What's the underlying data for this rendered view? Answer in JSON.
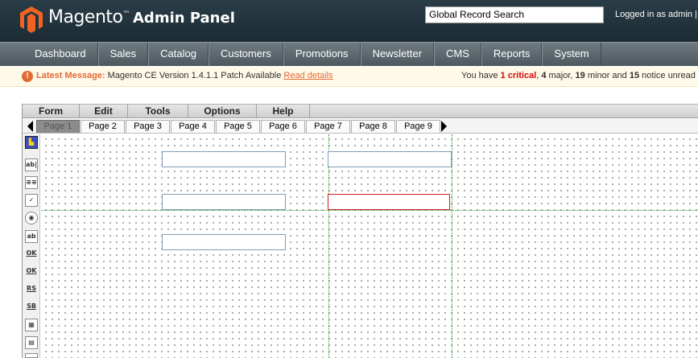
{
  "header": {
    "logo_text": "Magento",
    "logo_tm": "™",
    "logo_sub": "Admin Panel",
    "search_value": "Global Record Search",
    "logged_in": "Logged in as admin  |"
  },
  "nav": {
    "items": [
      "Dashboard",
      "Sales",
      "Catalog",
      "Customers",
      "Promotions",
      "Newsletter",
      "CMS",
      "Reports",
      "System"
    ]
  },
  "message": {
    "icon": "!",
    "latest_label": "Latest Message:",
    "text": "Magento CE Version 1.4.1.1 Patch Available",
    "link": "Read details",
    "right_prefix": "You have",
    "critical_count": "1",
    "critical_label": "critical",
    "major": "4",
    "major_label": "major,",
    "minor": "19",
    "minor_label": "minor and",
    "notice": "15",
    "notice_label": "notice unread m"
  },
  "builder": {
    "menu": [
      "Form",
      "Edit",
      "Tools",
      "Options",
      "Help"
    ],
    "pages": [
      "Page 1",
      "Page 2",
      "Page 3",
      "Page 4",
      "Page 5",
      "Page 6",
      "Page 7",
      "Page 8",
      "Page 9"
    ],
    "active_page": "Page 1",
    "tools": [
      {
        "name": "pointer-tool-icon",
        "label": ""
      },
      {
        "name": "textfield-tool-icon",
        "label": "ab|"
      },
      {
        "name": "textarea-tool-icon",
        "label": "≡≡"
      },
      {
        "name": "checkbox-tool-icon",
        "label": "✓"
      },
      {
        "name": "radio-tool-icon",
        "label": "◉"
      },
      {
        "name": "image-tool-icon",
        "label": "ab"
      },
      {
        "name": "ok1-button-tool-icon",
        "label": "OK"
      },
      {
        "name": "ok2-button-tool-icon",
        "label": "OK"
      },
      {
        "name": "reset-button-tool-icon",
        "label": "RS"
      },
      {
        "name": "submit-button-tool-icon",
        "label": "SB"
      },
      {
        "name": "table-tool-icon",
        "label": "▦"
      },
      {
        "name": "list-tool-icon",
        "label": "▤"
      },
      {
        "name": "select-tool-icon",
        "label": "▤"
      }
    ]
  }
}
